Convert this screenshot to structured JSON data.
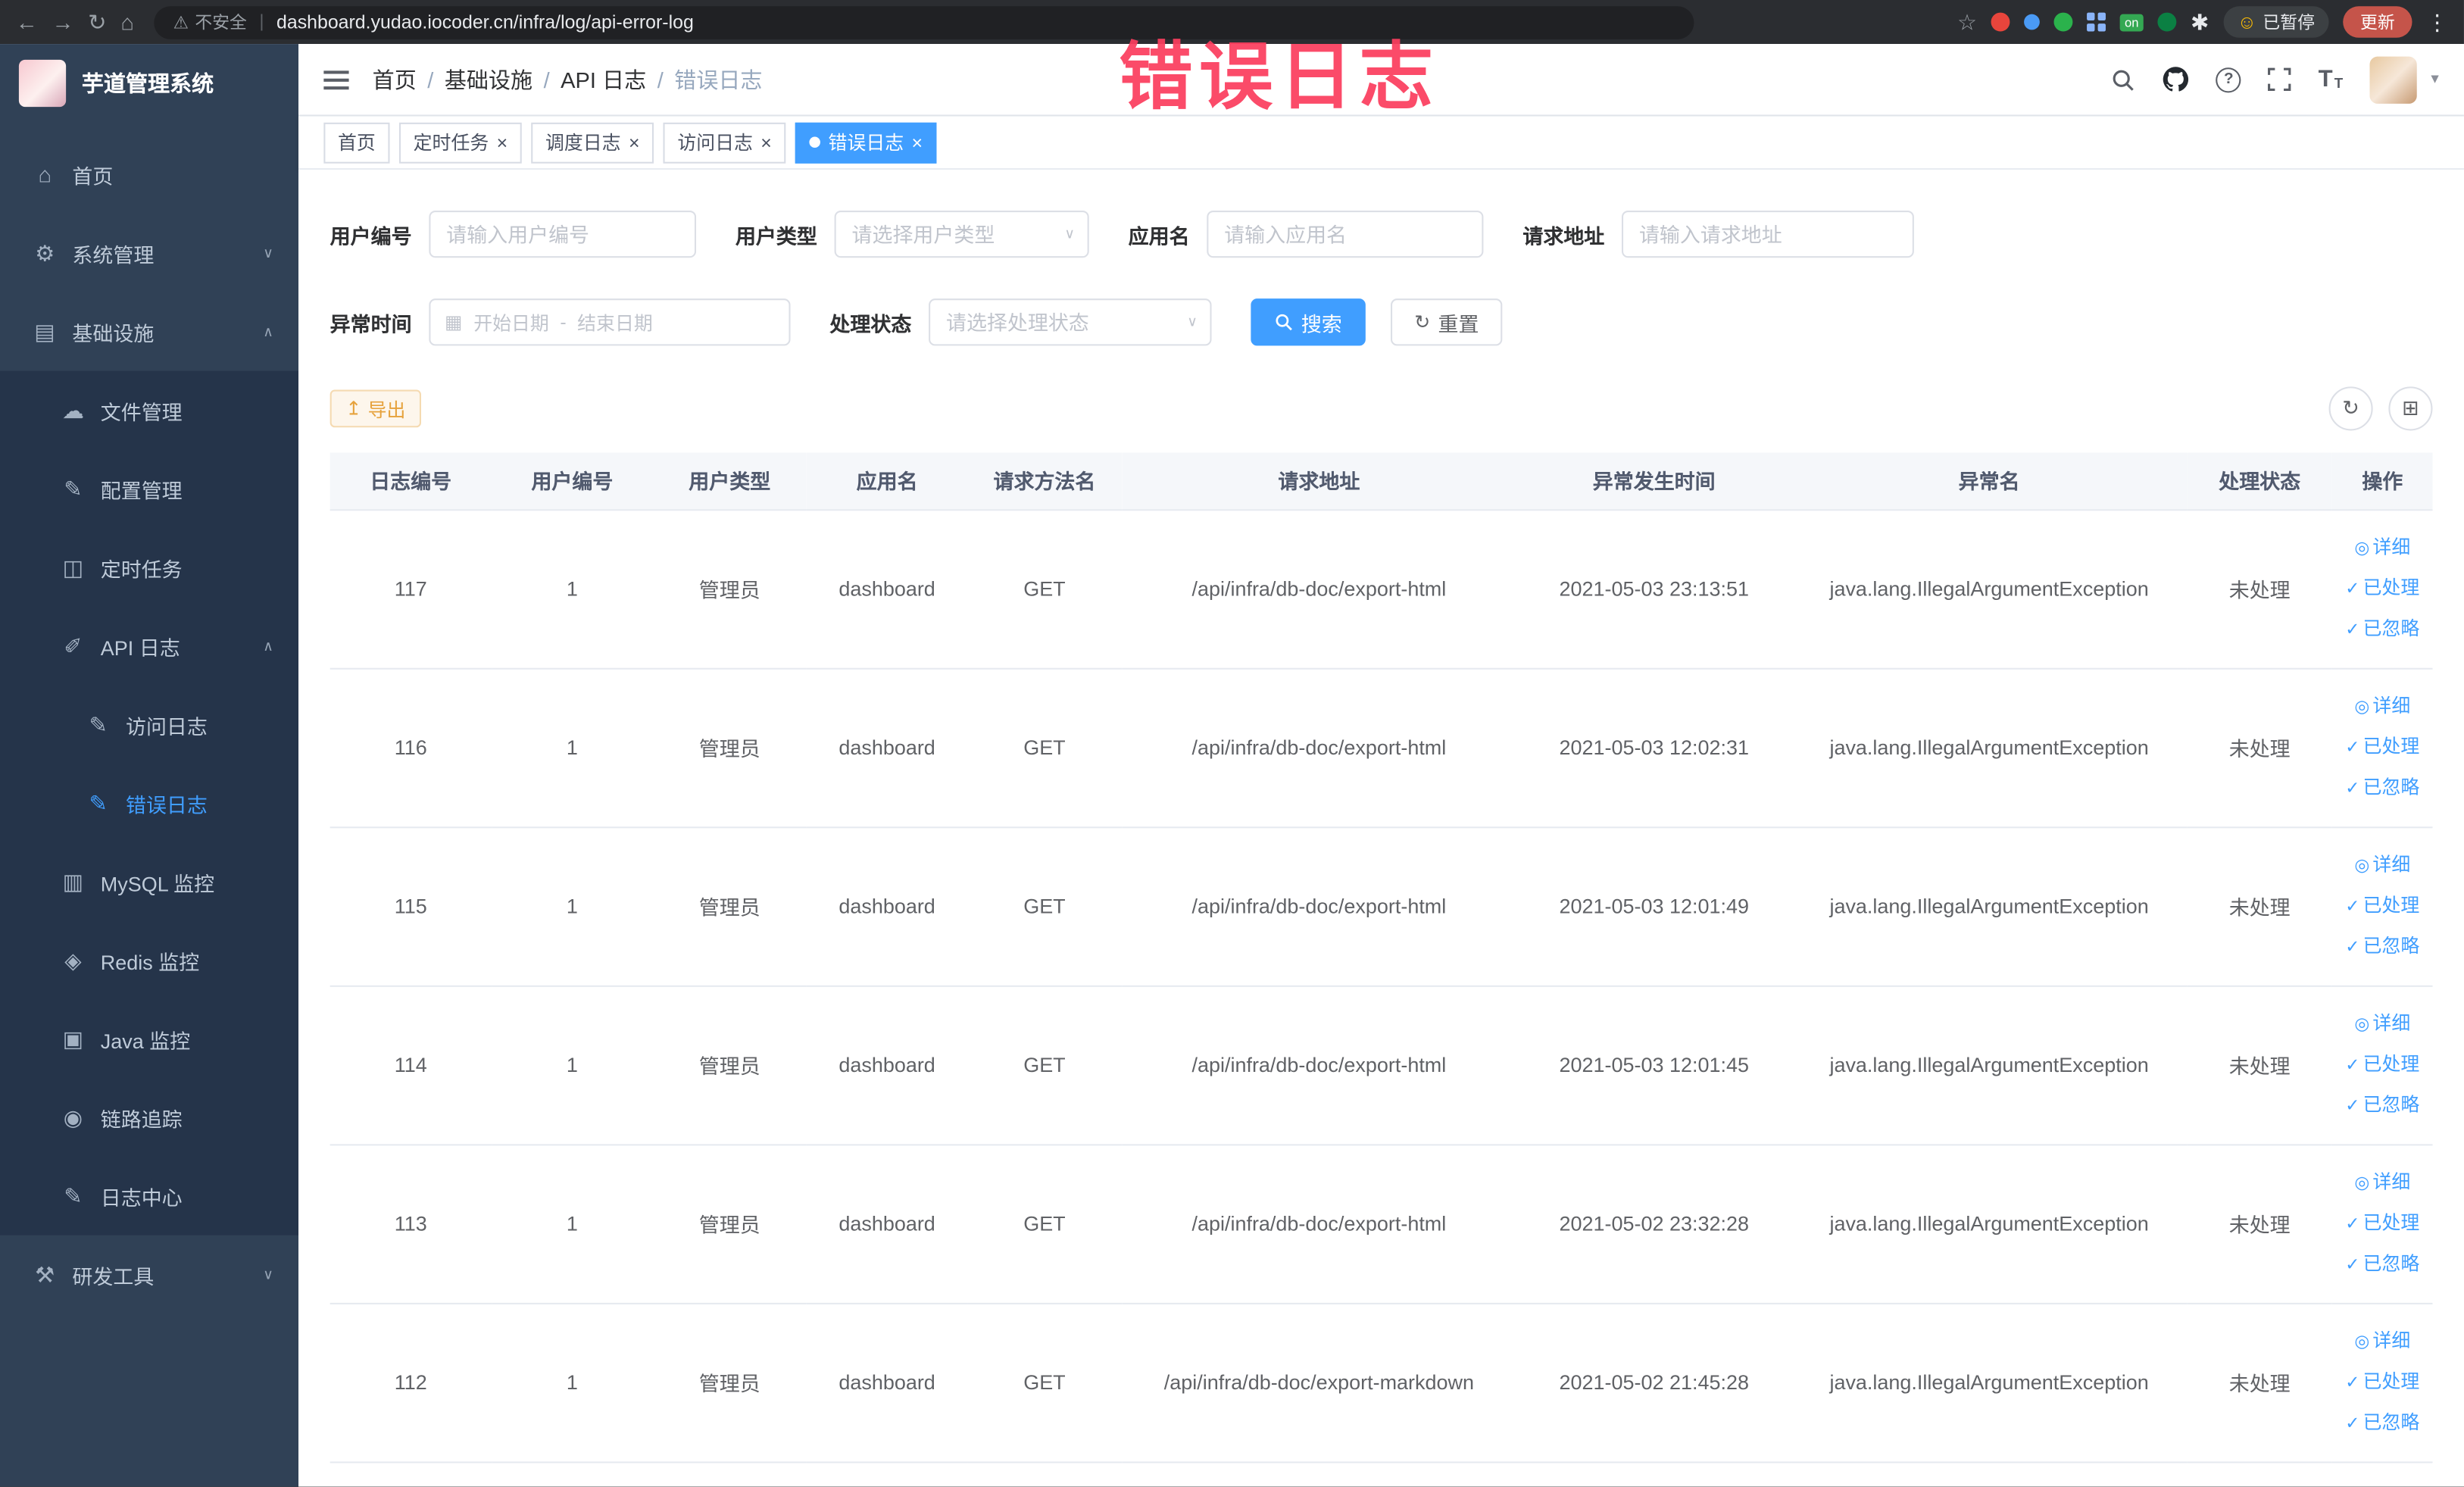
{
  "annotation": {
    "text": "错误日志"
  },
  "browser": {
    "security_label": "不安全",
    "url": "dashboard.yudao.iocoder.cn/infra/log/api-error-log",
    "on_badge": "on",
    "paused_label": "已暂停",
    "update_label": "更新"
  },
  "sidebar": {
    "logo_title": "芋道管理系统",
    "menu": {
      "home": "首页",
      "system": "系统管理",
      "infra": "基础设施",
      "file": "文件管理",
      "config": "配置管理",
      "job": "定时任务",
      "api_log": "API 日志",
      "access_log": "访问日志",
      "error_log": "错误日志",
      "mysql": "MySQL 监控",
      "redis": "Redis 监控",
      "java": "Java 监控",
      "trace": "链路追踪",
      "log_center": "日志中心",
      "dev_tools": "研发工具"
    }
  },
  "header": {
    "breadcrumbs": [
      "首页",
      "基础设施",
      "API 日志",
      "错误日志"
    ],
    "separator": "/"
  },
  "tabs": {
    "items": [
      {
        "label": "首页"
      },
      {
        "label": "定时任务"
      },
      {
        "label": "调度日志"
      },
      {
        "label": "访问日志"
      },
      {
        "label": "错误日志"
      }
    ]
  },
  "filters": {
    "user_id_label": "用户编号",
    "user_id_placeholder": "请输入用户编号",
    "user_type_label": "用户类型",
    "user_type_placeholder": "请选择用户类型",
    "app_name_label": "应用名",
    "app_name_placeholder": "请输入应用名",
    "request_url_label": "请求地址",
    "request_url_placeholder": "请输入请求地址",
    "time_label": "异常时间",
    "time_start_placeholder": "开始日期",
    "time_separator": "-",
    "time_end_placeholder": "结束日期",
    "status_label": "处理状态",
    "status_placeholder": "请选择处理状态",
    "search_label": "搜索",
    "reset_label": "重置"
  },
  "toolbar": {
    "export_label": "导出"
  },
  "table": {
    "columns": [
      "日志编号",
      "用户编号",
      "用户类型",
      "应用名",
      "请求方法名",
      "请求地址",
      "异常发生时间",
      "异常名",
      "处理状态",
      "操作"
    ],
    "action_labels": [
      "详细",
      "已处理",
      "已忽略"
    ],
    "rows": [
      {
        "id": "117",
        "user_id": "1",
        "user_type": "管理员",
        "app": "dashboard",
        "method": "GET",
        "url": "/api/infra/db-doc/export-html",
        "time": "2021-05-03 23:13:51",
        "exception": "java.lang.IllegalArgumentException",
        "status": "未处理"
      },
      {
        "id": "116",
        "user_id": "1",
        "user_type": "管理员",
        "app": "dashboard",
        "method": "GET",
        "url": "/api/infra/db-doc/export-html",
        "time": "2021-05-03 12:02:31",
        "exception": "java.lang.IllegalArgumentException",
        "status": "未处理"
      },
      {
        "id": "115",
        "user_id": "1",
        "user_type": "管理员",
        "app": "dashboard",
        "method": "GET",
        "url": "/api/infra/db-doc/export-html",
        "time": "2021-05-03 12:01:49",
        "exception": "java.lang.IllegalArgumentException",
        "status": "未处理"
      },
      {
        "id": "114",
        "user_id": "1",
        "user_type": "管理员",
        "app": "dashboard",
        "method": "GET",
        "url": "/api/infra/db-doc/export-html",
        "time": "2021-05-03 12:01:45",
        "exception": "java.lang.IllegalArgumentException",
        "status": "未处理"
      },
      {
        "id": "113",
        "user_id": "1",
        "user_type": "管理员",
        "app": "dashboard",
        "method": "GET",
        "url": "/api/infra/db-doc/export-html",
        "time": "2021-05-02 23:32:28",
        "exception": "java.lang.IllegalArgumentException",
        "status": "未处理"
      },
      {
        "id": "112",
        "user_id": "1",
        "user_type": "管理员",
        "app": "dashboard",
        "method": "GET",
        "url": "/api/infra/db-doc/export-markdown",
        "time": "2021-05-02 21:45:28",
        "exception": "java.lang.IllegalArgumentException",
        "status": "未处理"
      }
    ]
  },
  "icons": {
    "back": "←",
    "forward": "→",
    "reload": "↻",
    "home": "⌂",
    "warning": "⚠",
    "star": "☆",
    "kebab": "⋮",
    "smiley": "☺",
    "asterisk": "✱",
    "divider": "|",
    "close": "×",
    "chevron_down": "∨",
    "chevron_up": "∧",
    "caret_down": "▾",
    "calendar": "▦",
    "export": "↥",
    "refresh": "↻",
    "grid": "⊞",
    "detail": "◎",
    "check": "✓",
    "help": "?",
    "font_size": "T",
    "menu_home": "⌂",
    "menu_system": "⚙",
    "menu_infra": "▤",
    "menu_file": "☁",
    "menu_config": "✎",
    "menu_job": "◫",
    "menu_api": "✐",
    "menu_access": "✎",
    "menu_error": "✎",
    "menu_mysql": "▥",
    "menu_redis": "◈",
    "menu_java": "▣",
    "menu_trace": "◉",
    "menu_log_center": "✎",
    "menu_dev": "⚒"
  },
  "colors": {
    "primary": "#409EFF",
    "warning": "#E6A23C",
    "annotation_red": "#FB3E5E",
    "sidebar_bg": "#304156",
    "submenu_bg": "#25344A"
  }
}
